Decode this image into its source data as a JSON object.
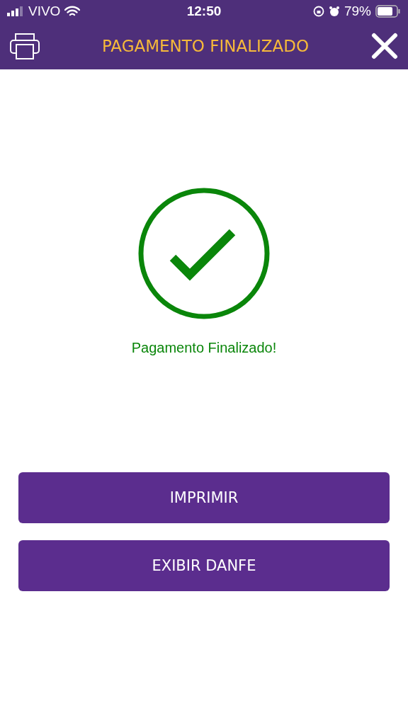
{
  "status_bar": {
    "carrier": "VIVO",
    "time": "12:50",
    "battery": "79%"
  },
  "header": {
    "title": "PAGAMENTO FINALIZADO"
  },
  "message": "Pagamento Finalizado!",
  "buttons": [
    "IMPRIMIR",
    "EXIBIR DANFE"
  ]
}
